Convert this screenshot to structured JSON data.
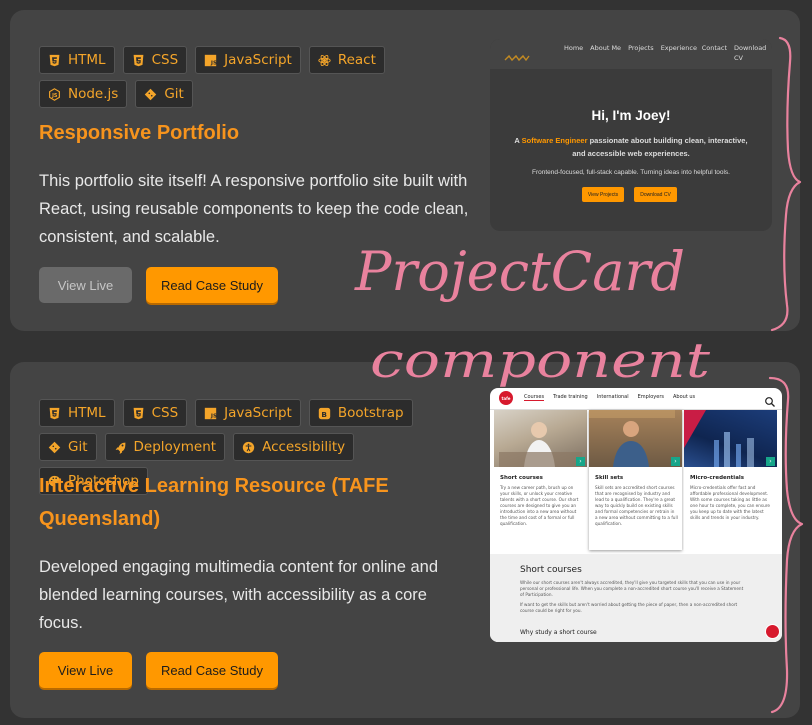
{
  "colors": {
    "accent": "#ff9800",
    "card_bg": "#444444",
    "page_bg": "#333333",
    "annotation": "#e9829e"
  },
  "projects": [
    {
      "tags": [
        {
          "label": "HTML",
          "icon": "html5-icon"
        },
        {
          "label": "CSS",
          "icon": "css3-icon"
        },
        {
          "label": "JavaScript",
          "icon": "js-icon"
        },
        {
          "label": "React",
          "icon": "react-icon"
        },
        {
          "label": "Node.js",
          "icon": "nodejs-icon"
        },
        {
          "label": "Git",
          "icon": "git-icon"
        }
      ],
      "title": "Responsive Portfolio",
      "description": "This portfolio site itself! A responsive portfolio site built with React, using reusable components to keep the code clean, consistent, and scalable.",
      "buttons": {
        "live": "View Live",
        "case_study": "Read Case Study"
      },
      "preview": {
        "nav": [
          "Home",
          "About Me",
          "Projects",
          "Experience",
          "Contact",
          "Download CV"
        ],
        "hero_title": "Hi, I'm Joey!",
        "hero_prefix": "A ",
        "hero_highlight": "Software Engineer",
        "hero_rest": " passionate about building clean, interactive, and accessible web experiences.",
        "hero_sub": "Frontend-focused, full-stack capable. Turning ideas into helpful tools.",
        "btn_projects": "View Projects",
        "btn_cv": "Download CV"
      }
    },
    {
      "tags": [
        {
          "label": "HTML",
          "icon": "html5-icon"
        },
        {
          "label": "CSS",
          "icon": "css3-icon"
        },
        {
          "label": "JavaScript",
          "icon": "js-icon"
        },
        {
          "label": "Bootstrap",
          "icon": "bootstrap-icon"
        },
        {
          "label": "Git",
          "icon": "git-icon"
        },
        {
          "label": "Deployment",
          "icon": "rocket-icon"
        },
        {
          "label": "Accessibility",
          "icon": "accessibility-icon"
        },
        {
          "label": "Photoshop",
          "icon": "palette-icon"
        }
      ],
      "title": "Interactive Learning Resource (TAFE Queensland)",
      "description": "Developed engaging multimedia content for online and blended learning courses, with accessibility as a core focus.",
      "buttons": {
        "live": "View Live",
        "case_study": "Read Case Study"
      },
      "preview": {
        "logo": "tafe",
        "nav": [
          "Courses",
          "Trade training",
          "International",
          "Employers",
          "About us"
        ],
        "cards": [
          {
            "title": "Short courses",
            "text": "Try a new career path, brush up on your skills, or unlock your creative talents with a short course. Our short courses are designed to give you an introduction into a new area without the time and cost of a formal or full qualification."
          },
          {
            "title": "Skill sets",
            "text": "Skill sets are accredited short courses that are recognised by industry and lead to a qualification. They're a great way to quickly build on existing skills and formal competencies or retrain in a new area without committing to a full qualification."
          },
          {
            "title": "Micro-credentials",
            "text": "Micro-credentials offer fast and affordable professional development. With some courses taking as little as one hour to complete, you can ensure you keep up to date with the latest skills and trends in your industry."
          }
        ],
        "section_title": "Short courses",
        "section_text_1": "While our short courses aren't always accredited, they'll give you targeted skills that you can use in your personal or professional life. When you complete a non-accredited short course you'll receive a Statement of Participation.",
        "section_text_2": "If want to get the skills but aren't worried about getting the piece of paper, then a non-accredited short course could be right for you.",
        "section_sub": "Why study a short course"
      }
    }
  ],
  "annotation": {
    "line1": "ProjectCard",
    "line2": "component"
  }
}
